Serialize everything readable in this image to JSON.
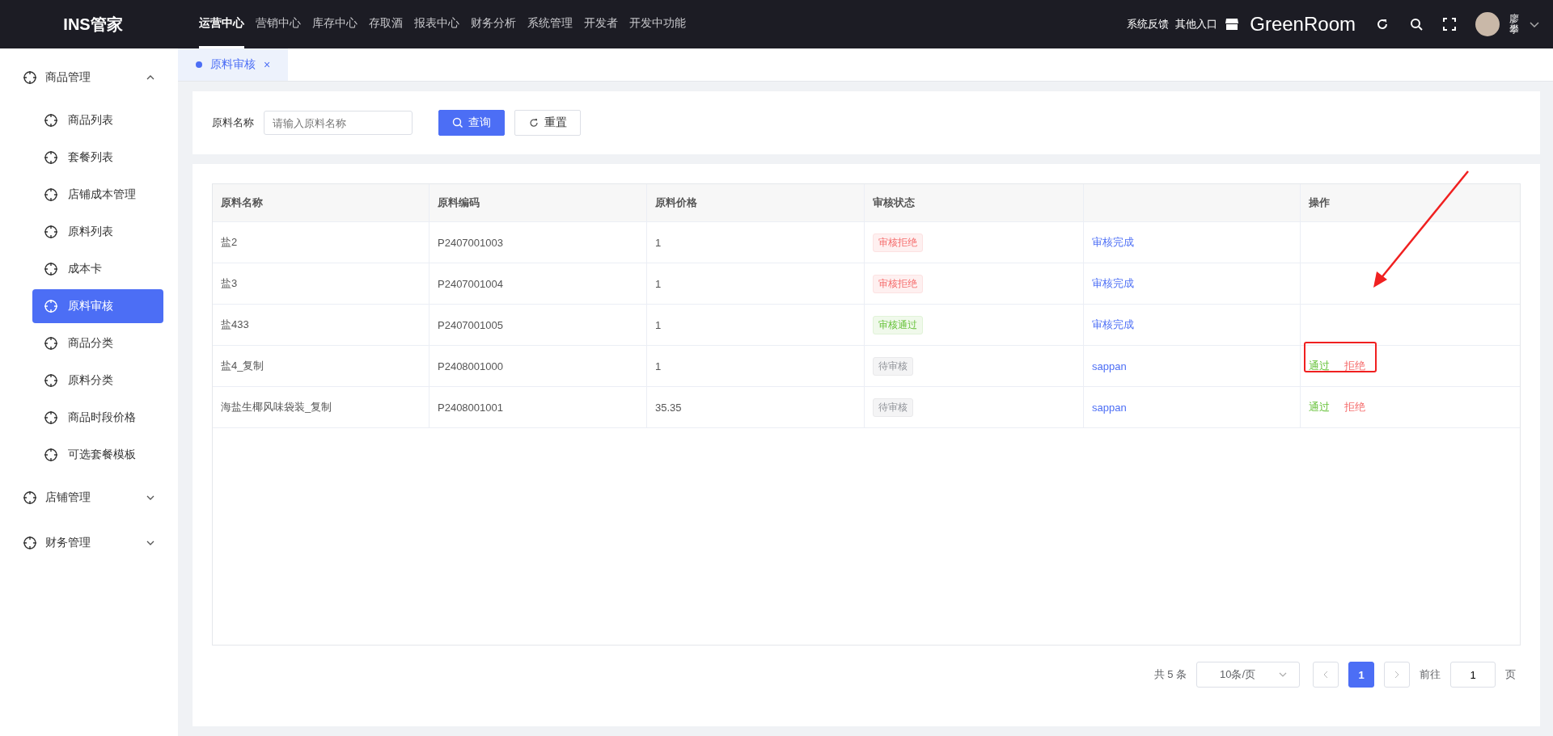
{
  "header": {
    "logo": "INS管家",
    "nav": [
      {
        "label": "运营中心",
        "selected": true
      },
      {
        "label": "营销中心",
        "selected": false
      },
      {
        "label": "库存中心",
        "selected": false
      },
      {
        "label": "存取酒",
        "selected": false
      },
      {
        "label": "报表中心",
        "selected": false
      },
      {
        "label": "财务分析",
        "selected": false
      },
      {
        "label": "系统管理",
        "selected": false
      },
      {
        "label": "开发者",
        "selected": false
      },
      {
        "label": "开发中功能",
        "selected": false
      }
    ],
    "links": [
      "系统反馈",
      "其他入口"
    ],
    "store": "GreenRoom",
    "user": "廖攀"
  },
  "sidebar": {
    "groups": [
      {
        "label": "商品管理",
        "expanded": true,
        "children": [
          {
            "label": "商品列表",
            "selected": false
          },
          {
            "label": "套餐列表",
            "selected": false
          },
          {
            "label": "店铺成本管理",
            "selected": false
          },
          {
            "label": "原料列表",
            "selected": false
          },
          {
            "label": "成本卡",
            "selected": false
          },
          {
            "label": "原料审核",
            "selected": true
          },
          {
            "label": "商品分类",
            "selected": false
          },
          {
            "label": "原料分类",
            "selected": false
          },
          {
            "label": "商品时段价格",
            "selected": false
          },
          {
            "label": "可选套餐模板",
            "selected": false
          }
        ]
      },
      {
        "label": "店铺管理",
        "expanded": false
      },
      {
        "label": "财务管理",
        "expanded": false
      }
    ]
  },
  "tabs": [
    {
      "label": "原料审核",
      "selected": true,
      "close": "×"
    }
  ],
  "filter": {
    "label": "原料名称",
    "placeholder": "请输入原料名称",
    "search_button": "查询",
    "reset_button": "重置"
  },
  "table": {
    "columns": [
      {
        "label": "原料名称"
      },
      {
        "label": "原料编码"
      },
      {
        "label": "原料价格"
      },
      {
        "label": "审核状态"
      },
      {},
      {
        "label": "操作"
      }
    ],
    "rows": [
      {
        "name": "盐2",
        "code": "P2407001003",
        "price": "1",
        "status": {
          "label": "审核拒绝",
          "kind": "rejected"
        },
        "column_5": "审核完成",
        "actions": []
      },
      {
        "name": "盐3",
        "code": "P2407001004",
        "price": "1",
        "status": {
          "label": "审核拒绝",
          "kind": "rejected"
        },
        "column_5": "审核完成",
        "actions": []
      },
      {
        "name": "盐433",
        "code": "P2407001005",
        "price": "1",
        "status": {
          "label": "审核通过",
          "kind": "approved"
        },
        "column_5": "审核完成",
        "actions": []
      },
      {
        "name": "盐4_复制",
        "code": "P2408001000",
        "price": "1",
        "status": {
          "label": "待审核",
          "kind": "pending"
        },
        "column_5": "sappan",
        "actions": [
          {
            "label": "通过",
            "kind": "approve"
          },
          {
            "label": "拒绝",
            "kind": "reject"
          }
        ]
      },
      {
        "name": "海盐生椰风味袋装_复制",
        "code": "P2408001001",
        "price": "35.35",
        "status": {
          "label": "待审核",
          "kind": "pending"
        },
        "column_5": "sappan",
        "actions": [
          {
            "label": "通过",
            "kind": "approve"
          },
          {
            "label": "拒绝",
            "kind": "reject"
          }
        ]
      }
    ]
  },
  "pagination": {
    "total": "共 5 条",
    "page_size": "10条/页",
    "pages": [
      {
        "label": "1",
        "selected": true
      }
    ],
    "goto_label": "前往",
    "goto_value": "1",
    "goto_suffix": "页"
  }
}
